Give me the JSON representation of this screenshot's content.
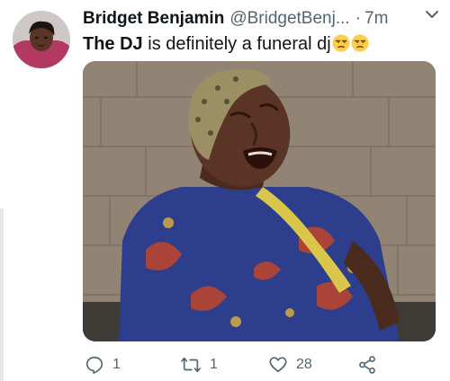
{
  "tweet": {
    "author": {
      "display_name": "Bridget Benjamin",
      "handle": "@BridgetBenj...",
      "separator": "·",
      "time": "7m",
      "avatar": "profile-photo"
    },
    "text": {
      "bold_part": "The DJ",
      "rest": " is definitely a funeral dj",
      "emojis": [
        "unamused-face-emoji",
        "unamused-face-emoji"
      ]
    },
    "media": {
      "image": "woman-crying-in-blue-patterned-dress-photo"
    },
    "actions": {
      "reply": {
        "icon": "reply-icon",
        "count": "1"
      },
      "retweet": {
        "icon": "retweet-icon",
        "count": "1"
      },
      "like": {
        "icon": "heart-icon",
        "count": "28"
      },
      "share": {
        "icon": "share-icon"
      }
    }
  },
  "colors": {
    "text_primary": "#0f1419",
    "text_secondary": "#536471",
    "background": "#ffffff"
  }
}
